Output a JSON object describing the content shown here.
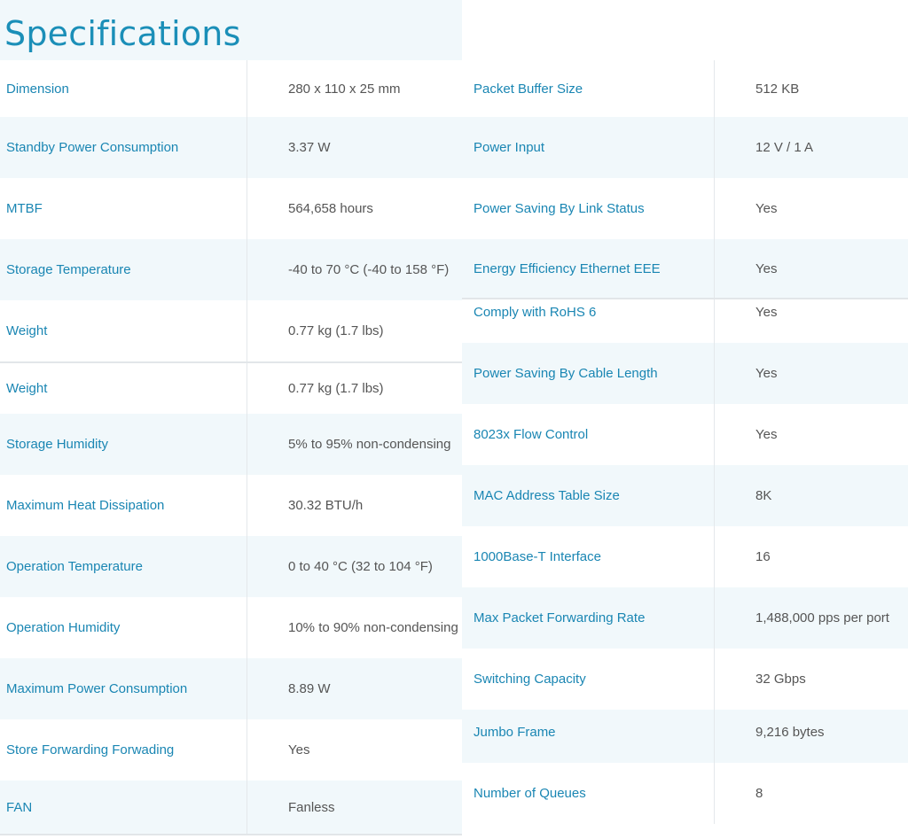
{
  "page": {
    "title": "Specifications"
  },
  "left_specs": [
    {
      "label": "Dimension",
      "value": "280 x 110 x 25 mm"
    },
    {
      "label": "Standby Power Consumption",
      "value": "3.37 W"
    },
    {
      "label": "MTBF",
      "value": "564,658 hours"
    },
    {
      "label": "Storage Temperature",
      "value": "-40 to 70 °C (-40 to 158 °F)"
    },
    {
      "label": "Weight",
      "value": "0.77 kg (1.7 lbs)"
    },
    {
      "label": "Weight",
      "value": "0.77 kg (1.7 lbs)"
    },
    {
      "label": "Storage Humidity",
      "value": "5% to 95% non-condensing"
    },
    {
      "label": "Maximum Heat Dissipation",
      "value": "30.32 BTU/h"
    },
    {
      "label": "Operation Temperature",
      "value": "0 to 40 °C (32 to 104 °F)"
    },
    {
      "label": "Operation Humidity",
      "value": "10% to 90% non-condensing"
    },
    {
      "label": "Maximum Power Consumption",
      "value": "8.89 W"
    },
    {
      "label": "Store Forwarding Forwading",
      "value": "Yes"
    },
    {
      "label": "FAN",
      "value": "Fanless"
    }
  ],
  "right_specs": [
    {
      "label": "Packet Buffer Size",
      "value": "512 KB"
    },
    {
      "label": "Power Input",
      "value": "12 V / 1 A"
    },
    {
      "label": "Power Saving By Link Status",
      "value": "Yes"
    },
    {
      "label": "Energy Efficiency Ethernet EEE",
      "value": "Yes"
    },
    {
      "label": "Comply with RoHS 6",
      "value": "Yes"
    },
    {
      "label": "Power Saving By Cable Length",
      "value": "Yes"
    },
    {
      "label": "8023x Flow Control",
      "value": "Yes"
    },
    {
      "label": "MAC Address Table Size",
      "value": "8K"
    },
    {
      "label": "1000Base-T Interface",
      "value": "16"
    },
    {
      "label": "Max Packet Forwarding Rate",
      "value": "1,488,000 pps per port"
    },
    {
      "label": "Switching Capacity",
      "value": "32 Gbps"
    },
    {
      "label": "Jumbo Frame",
      "value": "9,216 bytes"
    },
    {
      "label": "Number of Queues",
      "value": "8"
    }
  ],
  "colors": {
    "accent": "#1a86b3",
    "title": "#1b8fb8",
    "value_text": "#555555",
    "shade": "#f1f8fb",
    "divider": "#e2e6e9"
  }
}
